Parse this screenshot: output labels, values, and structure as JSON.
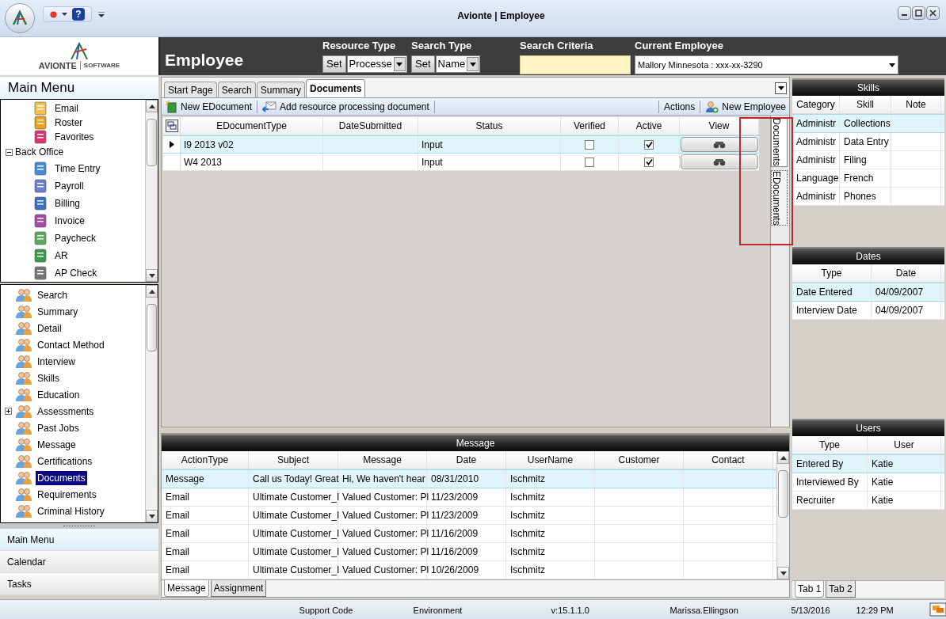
{
  "window": {
    "title": "Avionte | Employee"
  },
  "quick_access": {
    "help": "?"
  },
  "header": {
    "logo": "AVIONTE",
    "logo_sub": "SOFTWARE",
    "title": "Employee",
    "fields": [
      {
        "kind": "set_dropdown",
        "label": "Resource Type",
        "button": "Set",
        "value": "Processe"
      },
      {
        "kind": "set_dropdown",
        "label": "Search Type",
        "button": "Set",
        "value": "Name"
      },
      {
        "kind": "text",
        "label": "Search Criteria"
      },
      {
        "kind": "combo",
        "label": "Current Employee",
        "value": "Mallory  Minnesota : xxx-xx-3290"
      }
    ]
  },
  "sidebar": {
    "title": "Main Menu",
    "upper_tree": [
      {
        "label": "Email"
      },
      {
        "label": "Roster"
      },
      {
        "label": "Favorites"
      },
      {
        "label": "Back Office",
        "expanded": true,
        "children": [
          {
            "label": "Time Entry"
          },
          {
            "label": "Payroll"
          },
          {
            "label": "Billing"
          },
          {
            "label": "Invoice"
          },
          {
            "label": "Paycheck"
          },
          {
            "label": "AR"
          },
          {
            "label": "AP Check"
          }
        ]
      }
    ],
    "lower_tree": [
      {
        "label": "Search",
        "selected": false
      },
      {
        "label": "Summary",
        "selected": false
      },
      {
        "label": "Detail",
        "selected": false
      },
      {
        "label": "Contact Method",
        "selected": false
      },
      {
        "label": "Interview",
        "selected": false
      },
      {
        "label": "Skills",
        "selected": false
      },
      {
        "label": "Education",
        "selected": false
      },
      {
        "label": "Assessments",
        "selected": false,
        "expanded": false
      },
      {
        "label": "Past Jobs",
        "selected": false
      },
      {
        "label": "Message",
        "selected": false
      },
      {
        "label": "Certifications",
        "selected": false
      },
      {
        "label": "Documents",
        "selected": true
      },
      {
        "label": "Requirements",
        "selected": false
      },
      {
        "label": "Criminal History",
        "selected": false
      }
    ],
    "nav": [
      {
        "label": "Main Menu",
        "selected": true
      },
      {
        "label": "Calendar",
        "selected": false
      },
      {
        "label": "Tasks",
        "selected": false
      }
    ]
  },
  "tabs": [
    {
      "label": "Start Page",
      "selected": false
    },
    {
      "label": "Search",
      "selected": false
    },
    {
      "label": "Summary",
      "selected": false
    },
    {
      "label": "Documents",
      "selected": true
    }
  ],
  "toolbar": {
    "left": [
      "New EDocument",
      "Add resource processing document"
    ],
    "actions": "Actions",
    "new_employee": "New Employee"
  },
  "documents": {
    "columns": [
      "EDocumentType",
      "DateSubmitted",
      "Status",
      "Verified",
      "Active",
      "View"
    ],
    "rows": [
      {
        "type": "I9 2013 v02",
        "status": "Input",
        "verified": false,
        "active": true,
        "selected": true
      },
      {
        "type": "W4 2013",
        "status": "Input",
        "verified": false,
        "active": true,
        "selected": false
      }
    ]
  },
  "side_tabs": [
    {
      "label": "Documents",
      "selected": true
    },
    {
      "label": "EDocuments",
      "selected": false
    }
  ],
  "messages": {
    "title": "Message",
    "columns": [
      "ActionType",
      "Subject",
      "Message",
      "Date",
      "UserName",
      "Customer",
      "Contact"
    ],
    "rows": [
      {
        "cells": [
          "Message",
          "Call us Today!  Great",
          "Hi, We haven't hear",
          "08/31/2010",
          "Ischmitz"
        ],
        "selected": true
      },
      {
        "cells": [
          "Email",
          "Ultimate Customer_I",
          "Valued Customer: Pl",
          "11/23/2009",
          "Ischmitz"
        ],
        "selected": false
      },
      {
        "cells": [
          "Email",
          "Ultimate Customer_I",
          "Valued Customer: Pl",
          "11/23/2009",
          "Ischmitz"
        ],
        "selected": false
      },
      {
        "cells": [
          "Email",
          "Ultimate Customer_I",
          "Valued Customer: Pl",
          "11/16/2009",
          "Ischmitz"
        ],
        "selected": false
      },
      {
        "cells": [
          "Email",
          "Ultimate Customer_I",
          "Valued Customer: Pl",
          "11/16/2009",
          "Ischmitz"
        ],
        "selected": false
      },
      {
        "cells": [
          "Email",
          "Ultimate Customer_I",
          "Valued Customer: Pl",
          "10/26/2009",
          "Ischmitz"
        ],
        "selected": false
      }
    ],
    "tabs": [
      {
        "label": "Message",
        "selected": true
      },
      {
        "label": "Assignment",
        "selected": false
      }
    ]
  },
  "panels": [
    {
      "title": "Skills",
      "columns": [
        "Category",
        "Skill",
        "Note"
      ],
      "rows": [
        {
          "cells": [
            "Administr",
            "Collections"
          ],
          "selected": true
        },
        {
          "cells": [
            "Administr",
            "Data Entry"
          ],
          "selected": false
        },
        {
          "cells": [
            "Administr",
            "Filing"
          ],
          "selected": false
        },
        {
          "cells": [
            "Language",
            "French"
          ],
          "selected": false
        },
        {
          "cells": [
            "Administr",
            "Phones"
          ],
          "selected": false
        }
      ]
    },
    {
      "title": "Dates",
      "columns": [
        "Type",
        "Date"
      ],
      "rows": [
        {
          "cells": [
            "Date Entered",
            "04/09/2007"
          ],
          "selected": true
        },
        {
          "cells": [
            "Interview Date",
            "04/09/2007"
          ],
          "selected": false
        }
      ]
    },
    {
      "title": "Users",
      "columns": [
        "Type",
        "User"
      ],
      "rows": [
        {
          "cells": [
            "Entered By",
            "Katie"
          ],
          "selected": true
        },
        {
          "cells": [
            "Interviewed By",
            "Katie"
          ],
          "selected": false
        },
        {
          "cells": [
            "Recruiter",
            "Katie"
          ],
          "selected": false
        }
      ]
    }
  ],
  "right_tabs": [
    {
      "label": "Tab 1",
      "selected": true
    },
    {
      "label": "Tab 2",
      "selected": false
    }
  ],
  "status_bar": [
    "Support Code",
    "Environment",
    "v:15.1.1.0",
    "Marissa.Ellingson",
    "5/13/2016",
    "12:29 PM"
  ]
}
